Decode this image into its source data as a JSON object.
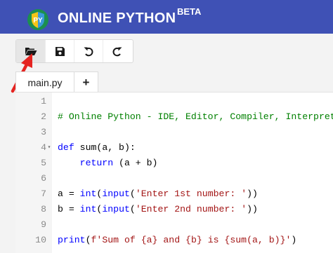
{
  "header": {
    "title": "ONLINE PYTHON",
    "beta": "BETA",
    "logo_text": "PY",
    "colors": {
      "bar": "#3f51b5",
      "logo_shield_left": "#f5c518",
      "logo_shield_right": "#3a9ad9",
      "logo_ring": "#1b8f4f"
    }
  },
  "toolbar": {
    "buttons": [
      {
        "name": "open",
        "icon": "folder-open-icon",
        "active": true
      },
      {
        "name": "save",
        "icon": "floppy-disk-icon",
        "active": false
      },
      {
        "name": "undo",
        "icon": "undo-icon",
        "active": false
      },
      {
        "name": "redo",
        "icon": "redo-icon",
        "active": false
      }
    ]
  },
  "annotation": {
    "icon": "red-arrow-icon",
    "color": "#e52421"
  },
  "tabs": {
    "active_file": "main.py",
    "add_label": "+"
  },
  "editor": {
    "lines": [
      {
        "n": "1",
        "fold": false,
        "tokens": []
      },
      {
        "n": "2",
        "fold": false,
        "tokens": [
          {
            "t": "cm",
            "v": "# Online Python - IDE, Editor, Compiler, Interpreter"
          }
        ]
      },
      {
        "n": "3",
        "fold": false,
        "tokens": []
      },
      {
        "n": "4",
        "fold": true,
        "tokens": [
          {
            "t": "kw",
            "v": "def"
          },
          {
            "t": "text",
            "v": " sum(a, b):"
          }
        ]
      },
      {
        "n": "5",
        "fold": false,
        "tokens": [
          {
            "t": "text",
            "v": "    "
          },
          {
            "t": "kw",
            "v": "return"
          },
          {
            "t": "text",
            "v": " (a + b)"
          }
        ]
      },
      {
        "n": "6",
        "fold": false,
        "tokens": []
      },
      {
        "n": "7",
        "fold": false,
        "tokens": [
          {
            "t": "text",
            "v": "a = "
          },
          {
            "t": "kw",
            "v": "int"
          },
          {
            "t": "text",
            "v": "("
          },
          {
            "t": "kw",
            "v": "input"
          },
          {
            "t": "text",
            "v": "("
          },
          {
            "t": "str",
            "v": "'Enter 1st number: '"
          },
          {
            "t": "text",
            "v": "))"
          }
        ]
      },
      {
        "n": "8",
        "fold": false,
        "tokens": [
          {
            "t": "text",
            "v": "b = "
          },
          {
            "t": "kw",
            "v": "int"
          },
          {
            "t": "text",
            "v": "("
          },
          {
            "t": "kw",
            "v": "input"
          },
          {
            "t": "text",
            "v": "("
          },
          {
            "t": "str",
            "v": "'Enter 2nd number: '"
          },
          {
            "t": "text",
            "v": "))"
          }
        ]
      },
      {
        "n": "9",
        "fold": false,
        "tokens": []
      },
      {
        "n": "10",
        "fold": false,
        "tokens": [
          {
            "t": "kw",
            "v": "print"
          },
          {
            "t": "text",
            "v": "("
          },
          {
            "t": "str",
            "v": "f'Sum of {a} and {b} is {sum(a, b)}'"
          },
          {
            "t": "text",
            "v": ")"
          }
        ]
      }
    ],
    "colors": {
      "keyword": "#0000ff",
      "string": "#a31515",
      "comment": "#008000",
      "line_number": "#8a8a8a"
    }
  }
}
